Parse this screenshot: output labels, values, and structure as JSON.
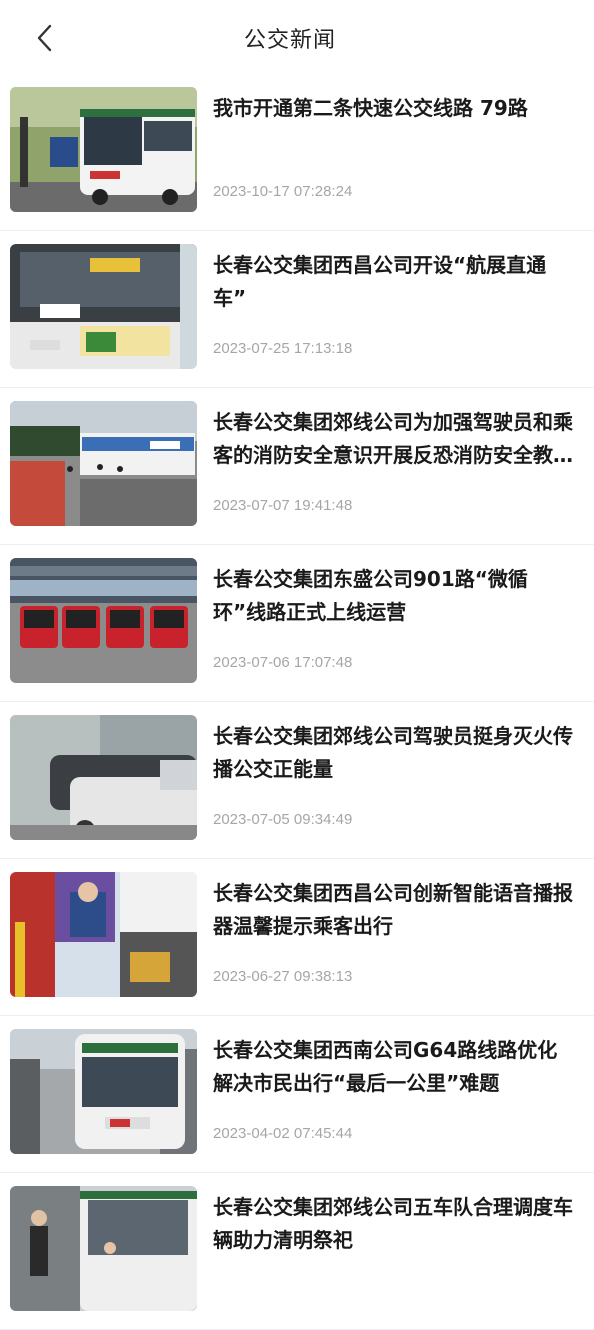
{
  "header": {
    "title": "公交新闻",
    "back_icon": "chevron-left-icon"
  },
  "news": [
    {
      "title": "我市开通第二条快速公交线路 79路",
      "date": "2023-10-17 07:28:24"
    },
    {
      "title": "长春公交集团西昌公司开设“航展直通车”",
      "date": "2023-07-25 17:13:18"
    },
    {
      "title": "长春公交集团郊线公司为加强驾驶员和乘客的消防安全意识开展反恐消防安全教育培训",
      "date": "2023-07-07 19:41:48"
    },
    {
      "title": "长春公交集团东盛公司901路“微循环”线路正式上线运营",
      "date": "2023-07-06 17:07:48"
    },
    {
      "title": "长春公交集团郊线公司驾驶员挺身灭火传播公交正能量",
      "date": "2023-07-05 09:34:49"
    },
    {
      "title": "长春公交集团西昌公司创新智能语音播报器温馨提示乘客出行",
      "date": "2023-06-27 09:38:13"
    },
    {
      "title": "长春公交集团西南公司G64路线路优化 解决市民出行“最后一公里”难题",
      "date": "2023-04-02 07:45:44"
    },
    {
      "title": "长春公交集团郊线公司五车队合理调度车辆助力清明祭祀",
      "date": ""
    }
  ]
}
